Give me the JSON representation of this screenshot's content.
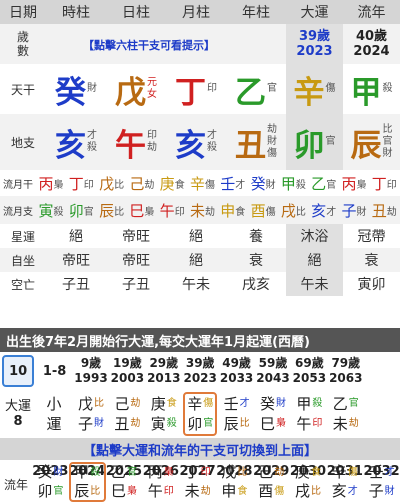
{
  "header": [
    "日期",
    "時柱",
    "日柱",
    "月柱",
    "年柱",
    "大運",
    "流年"
  ],
  "age_row": {
    "label_1": "歲",
    "label_2": "數",
    "hint": "【點擊六柱干支可看提示】",
    "dayun_age": "39歲",
    "dayun_year": "2023",
    "liunian_age": "40歲",
    "liunian_year": "2024"
  },
  "tiangan_label": "天干",
  "dizhi_label": "地支",
  "tiangan": [
    {
      "char": "癸",
      "color": "#1e3cc8",
      "cap": [
        "財",
        ""
      ]
    },
    {
      "char": "戊",
      "color": "#b86a12",
      "cap": [
        "元",
        "女"
      ],
      "cap_color": "#d02020"
    },
    {
      "char": "丁",
      "color": "#d02020",
      "cap": [
        "印",
        ""
      ]
    },
    {
      "char": "乙",
      "color": "#2a9a2a",
      "cap": [
        "官",
        ""
      ]
    },
    {
      "char": "辛",
      "color": "#c89a12",
      "cap": [
        "傷",
        ""
      ]
    },
    {
      "char": "甲",
      "color": "#2a9a2a",
      "cap": [
        "殺",
        ""
      ]
    }
  ],
  "dizhi": [
    {
      "char": "亥",
      "color": "#1e3cc8",
      "cap": [
        "才",
        "殺"
      ]
    },
    {
      "char": "午",
      "color": "#d02020",
      "cap": [
        "印",
        "劫"
      ]
    },
    {
      "char": "亥",
      "color": "#1e3cc8",
      "cap": [
        "才",
        "殺"
      ]
    },
    {
      "char": "丑",
      "color": "#b86a12",
      "cap": [
        "劫",
        "財",
        "傷"
      ]
    },
    {
      "char": "卯",
      "color": "#2a9a2a",
      "cap": [
        "官"
      ]
    },
    {
      "char": "辰",
      "color": "#b86a12",
      "cap": [
        "比",
        "官",
        "財"
      ]
    }
  ],
  "liuyue_label": "流月干",
  "liuyue_gan": [
    [
      "丙",
      "梟"
    ],
    [
      "丁",
      "印"
    ],
    [
      "戊",
      "比"
    ],
    [
      "己",
      "劫"
    ],
    [
      "庚",
      "食"
    ],
    [
      "辛",
      "傷"
    ],
    [
      "壬",
      "才"
    ],
    [
      "癸",
      "財"
    ],
    [
      "甲",
      "殺"
    ],
    [
      "乙",
      "官"
    ],
    [
      "丙",
      "梟"
    ],
    [
      "丁",
      "印"
    ]
  ],
  "liuyue_zhi_label": "流月支",
  "liuyue_zhi": [
    [
      "寅",
      "殺"
    ],
    [
      "卯",
      "官"
    ],
    [
      "辰",
      "比"
    ],
    [
      "巳",
      "梟"
    ],
    [
      "午",
      "印"
    ],
    [
      "未",
      "劫"
    ],
    [
      "申",
      "食"
    ],
    [
      "酉",
      "傷"
    ],
    [
      "戌",
      "比"
    ],
    [
      "亥",
      "才"
    ],
    [
      "子",
      "財"
    ],
    [
      "丑",
      "劫"
    ]
  ],
  "xingyun": {
    "label": "星運",
    "vals": [
      "絕",
      "帝旺",
      "絕",
      "養",
      "沐浴",
      "冠帶"
    ]
  },
  "zizuo": {
    "label": "自坐",
    "vals": [
      "帝旺",
      "帝旺",
      "絕",
      "衰",
      "絕",
      "衰"
    ]
  },
  "kongwang": {
    "label": "空亡",
    "vals": [
      "子丑",
      "子丑",
      "午未",
      "戌亥",
      "午未",
      "寅卯"
    ]
  },
  "banner": "出生後7年2月開始行大運,每交大運年1月起運(西曆)",
  "dayun_ages": [
    {
      "age": "10",
      "year": ""
    },
    {
      "age": "1-8",
      "year": ""
    },
    {
      "age": "9歲",
      "year": "1993"
    },
    {
      "age": "19歲",
      "year": "2003"
    },
    {
      "age": "29歲",
      "year": "2013"
    },
    {
      "age": "39歲",
      "year": "2023"
    },
    {
      "age": "49歲",
      "year": "2033"
    },
    {
      "age": "59歲",
      "year": "2043"
    },
    {
      "age": "69歲",
      "year": "2053"
    },
    {
      "age": "79歲",
      "year": "2063"
    }
  ],
  "dayun_label": [
    "大運",
    "8"
  ],
  "xiaoyun": [
    "小",
    "運"
  ],
  "dayun_gz": [
    [
      [
        "戊",
        "比"
      ],
      [
        "子",
        "財"
      ]
    ],
    [
      [
        "己",
        "劫"
      ],
      [
        "丑",
        "劫"
      ]
    ],
    [
      [
        "庚",
        "食"
      ],
      [
        "寅",
        "殺"
      ]
    ],
    [
      [
        "辛",
        "傷"
      ],
      [
        "卯",
        "官"
      ]
    ],
    [
      [
        "壬",
        "才"
      ],
      [
        "辰",
        "比"
      ]
    ],
    [
      [
        "癸",
        "財"
      ],
      [
        "巳",
        "梟"
      ]
    ],
    [
      [
        "甲",
        "殺"
      ],
      [
        "午",
        "印"
      ]
    ],
    [
      [
        "乙",
        "官"
      ],
      [
        "未",
        "劫"
      ]
    ]
  ],
  "hint2": "【點擊大運和流年的干支可切換到上面】",
  "liunian_years": [
    "2023",
    "2024",
    "2025",
    "2026",
    "2027",
    "2028",
    "2029",
    "2030",
    "2031",
    "2032"
  ],
  "liunian_label": "流年",
  "liunian_gz": [
    [
      [
        "癸",
        "財"
      ],
      [
        "卯",
        "官"
      ]
    ],
    [
      [
        "甲",
        "殺"
      ],
      [
        "辰",
        "比"
      ]
    ],
    [
      [
        "乙",
        "官"
      ],
      [
        "巳",
        "梟"
      ]
    ],
    [
      [
        "丙",
        "梟"
      ],
      [
        "午",
        "印"
      ]
    ],
    [
      [
        "丁",
        "印"
      ],
      [
        "未",
        "劫"
      ]
    ],
    [
      [
        "戊",
        "比"
      ],
      [
        "申",
        "食"
      ]
    ],
    [
      [
        "己",
        "劫"
      ],
      [
        "酉",
        "傷"
      ]
    ],
    [
      [
        "庚",
        "食"
      ],
      [
        "戌",
        "比"
      ]
    ],
    [
      [
        "辛",
        "傷"
      ],
      [
        "亥",
        "才"
      ]
    ],
    [
      [
        "壬",
        "才"
      ],
      [
        "子",
        "財"
      ]
    ]
  ],
  "colors": {
    "wood": "#2a9a2a",
    "fire": "#d02020",
    "earth": "#b86a12",
    "metal": "#c89a12",
    "water": "#1e3cc8"
  }
}
